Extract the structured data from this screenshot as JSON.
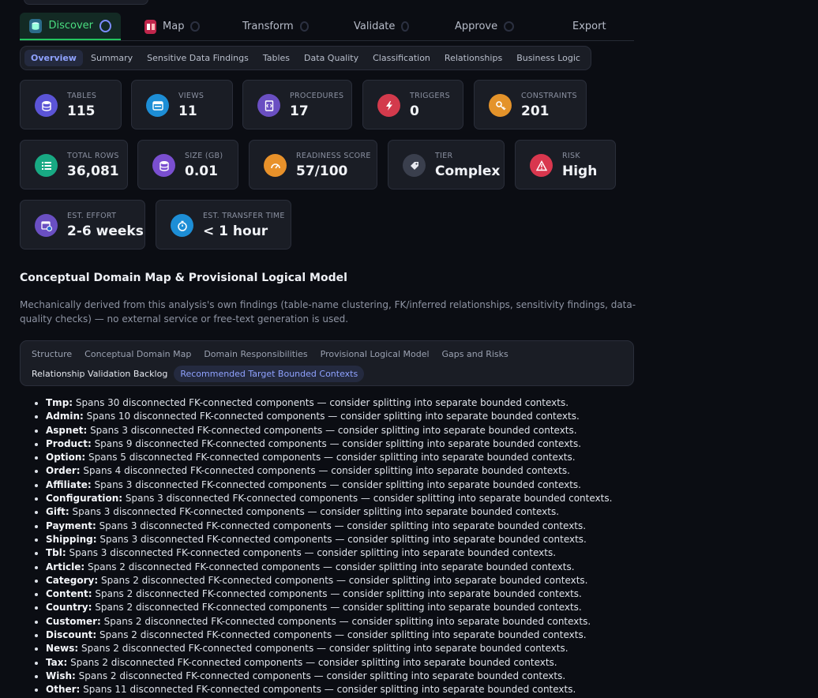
{
  "steps": [
    {
      "label": "Discover"
    },
    {
      "label": "Map"
    },
    {
      "label": "Transform"
    },
    {
      "label": "Validate"
    },
    {
      "label": "Approve"
    },
    {
      "label": "Export"
    }
  ],
  "subtabs": [
    "Overview",
    "Summary",
    "Sensitive Data Findings",
    "Tables",
    "Data Quality",
    "Classification",
    "Relationships",
    "Business Logic"
  ],
  "metrics": {
    "tables": {
      "label": "TABLES",
      "value": "115"
    },
    "views": {
      "label": "VIEWS",
      "value": "11"
    },
    "procedures": {
      "label": "PROCEDURES",
      "value": "17"
    },
    "triggers": {
      "label": "TRIGGERS",
      "value": "0"
    },
    "constraints": {
      "label": "CONSTRAINTS",
      "value": "201"
    },
    "total_rows": {
      "label": "TOTAL ROWS",
      "value": "36,081"
    },
    "size": {
      "label": "SIZE (GB)",
      "value": "0.01"
    },
    "readiness": {
      "label": "READINESS SCORE",
      "value": "57/100"
    },
    "tier": {
      "label": "TIER",
      "value": "Complex"
    },
    "risk": {
      "label": "RISK",
      "value": "High"
    },
    "effort": {
      "label": "EST. EFFORT",
      "value": "2-6 weeks"
    },
    "transfer": {
      "label": "EST. TRANSFER TIME",
      "value": "< 1 hour"
    }
  },
  "section": {
    "title": "Conceptual Domain Map & Provisional Logical Model",
    "description": "Mechanically derived from this analysis's own findings (table-name clustering, FK/inferred relationships, sensitivity findings, data-quality checks) — no external service or free-text generation is used."
  },
  "content_tabs": {
    "row1": [
      "Structure",
      "Conceptual Domain Map",
      "Domain Responsibilities",
      "Provisional Logical Model",
      "Gaps and Risks"
    ],
    "row2": [
      "Relationship Validation Backlog",
      "Recommended Target Bounded Contexts"
    ]
  },
  "recommendations": [
    {
      "name": "Tmp:",
      "text": " Spans 30 disconnected FK-connected components — consider splitting into separate bounded contexts."
    },
    {
      "name": "Admin:",
      "text": " Spans 10 disconnected FK-connected components — consider splitting into separate bounded contexts."
    },
    {
      "name": "Aspnet:",
      "text": " Spans 3 disconnected FK-connected components — consider splitting into separate bounded contexts."
    },
    {
      "name": "Product:",
      "text": " Spans 9 disconnected FK-connected components — consider splitting into separate bounded contexts."
    },
    {
      "name": "Option:",
      "text": " Spans 5 disconnected FK-connected components — consider splitting into separate bounded contexts."
    },
    {
      "name": "Order:",
      "text": " Spans 4 disconnected FK-connected components — consider splitting into separate bounded contexts."
    },
    {
      "name": "Affiliate:",
      "text": " Spans 3 disconnected FK-connected components — consider splitting into separate bounded contexts."
    },
    {
      "name": "Configuration:",
      "text": " Spans 3 disconnected FK-connected components — consider splitting into separate bounded contexts."
    },
    {
      "name": "Gift:",
      "text": " Spans 3 disconnected FK-connected components — consider splitting into separate bounded contexts."
    },
    {
      "name": "Payment:",
      "text": " Spans 3 disconnected FK-connected components — consider splitting into separate bounded contexts."
    },
    {
      "name": "Shipping:",
      "text": " Spans 3 disconnected FK-connected components — consider splitting into separate bounded contexts."
    },
    {
      "name": "Tbl:",
      "text": " Spans 3 disconnected FK-connected components — consider splitting into separate bounded contexts."
    },
    {
      "name": "Article:",
      "text": " Spans 2 disconnected FK-connected components — consider splitting into separate bounded contexts."
    },
    {
      "name": "Category:",
      "text": " Spans 2 disconnected FK-connected components — consider splitting into separate bounded contexts."
    },
    {
      "name": "Content:",
      "text": " Spans 2 disconnected FK-connected components — consider splitting into separate bounded contexts."
    },
    {
      "name": "Country:",
      "text": " Spans 2 disconnected FK-connected components — consider splitting into separate bounded contexts."
    },
    {
      "name": "Customer:",
      "text": " Spans 2 disconnected FK-connected components — consider splitting into separate bounded contexts."
    },
    {
      "name": "Discount:",
      "text": " Spans 2 disconnected FK-connected components — consider splitting into separate bounded contexts."
    },
    {
      "name": "News:",
      "text": " Spans 2 disconnected FK-connected components — consider splitting into separate bounded contexts."
    },
    {
      "name": "Tax:",
      "text": " Spans 2 disconnected FK-connected components — consider splitting into separate bounded contexts."
    },
    {
      "name": "Wish:",
      "text": " Spans 2 disconnected FK-connected components — consider splitting into separate bounded contexts."
    },
    {
      "name": "Other:",
      "text": " Spans 11 disconnected FK-connected components — consider splitting into separate bounded contexts."
    }
  ],
  "colors": {
    "background": "#0b0d13",
    "card": "#1a1d25",
    "accent_green": "#22c55e",
    "accent_blue": "#8fa2ff"
  }
}
